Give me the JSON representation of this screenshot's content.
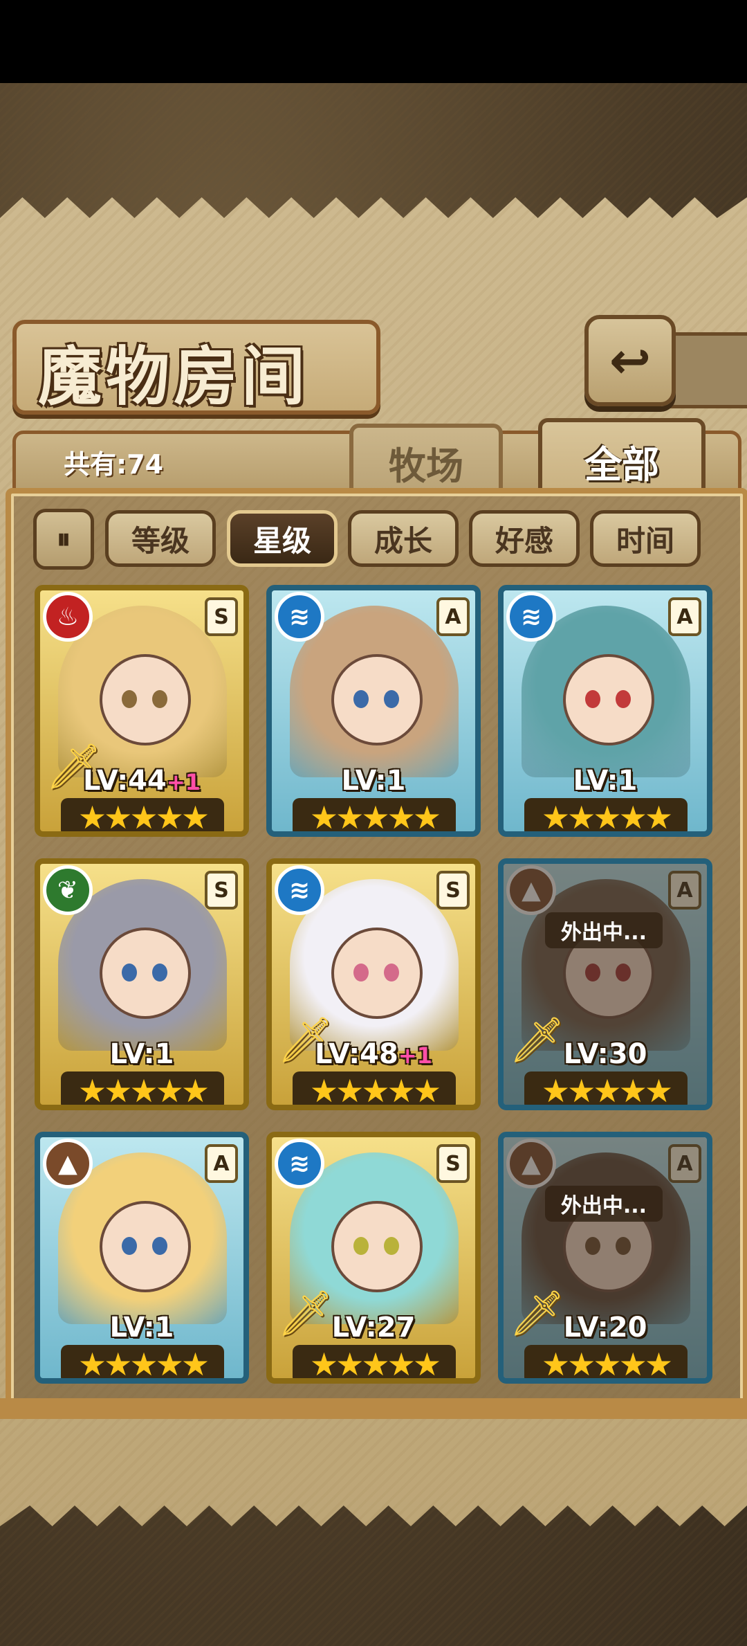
{
  "title": "魔物房间",
  "back_icon": "back-arrow-icon",
  "total_label": "共有:74",
  "tabs": [
    {
      "label": "牧场",
      "active": false
    },
    {
      "label": "全部",
      "active": true
    }
  ],
  "sort_toggle_icon": "sort-order-icon",
  "filters": [
    {
      "label": "等级",
      "active": false
    },
    {
      "label": "星级",
      "active": true
    },
    {
      "label": "成长",
      "active": false
    },
    {
      "label": "好感",
      "active": false
    },
    {
      "label": "时间",
      "active": false
    }
  ],
  "monsters": [
    {
      "element": "fire",
      "element_icon": "fire-element-icon",
      "rank": "S",
      "frame": "gold",
      "level": "LV:44",
      "bonus": "+1",
      "stars": 5,
      "sword": true,
      "away": false,
      "away_text": ""
    },
    {
      "element": "water",
      "element_icon": "water-element-icon",
      "rank": "A",
      "frame": "blue",
      "level": "LV:1",
      "bonus": "",
      "stars": 5,
      "sword": false,
      "away": false,
      "away_text": ""
    },
    {
      "element": "water",
      "element_icon": "water-element-icon",
      "rank": "A",
      "frame": "blue",
      "level": "LV:1",
      "bonus": "",
      "stars": 5,
      "sword": false,
      "away": false,
      "away_text": ""
    },
    {
      "element": "leaf",
      "element_icon": "leaf-element-icon",
      "rank": "S",
      "frame": "gold",
      "level": "LV:1",
      "bonus": "",
      "stars": 5,
      "sword": false,
      "away": false,
      "away_text": ""
    },
    {
      "element": "water",
      "element_icon": "water-element-icon",
      "rank": "S",
      "frame": "gold",
      "level": "LV:48",
      "bonus": "+1",
      "stars": 5,
      "sword": true,
      "away": false,
      "away_text": ""
    },
    {
      "element": "earth",
      "element_icon": "earth-element-icon",
      "rank": "A",
      "frame": "blue",
      "level": "LV:30",
      "bonus": "",
      "stars": 5,
      "sword": true,
      "away": true,
      "away_text": "外出中..."
    },
    {
      "element": "earth",
      "element_icon": "earth-element-icon",
      "rank": "A",
      "frame": "blue",
      "level": "LV:1",
      "bonus": "",
      "stars": 5,
      "sword": false,
      "away": false,
      "away_text": ""
    },
    {
      "element": "water",
      "element_icon": "water-element-icon",
      "rank": "S",
      "frame": "gold",
      "level": "LV:27",
      "bonus": "",
      "stars": 5,
      "sword": true,
      "away": false,
      "away_text": ""
    },
    {
      "element": "earth",
      "element_icon": "earth-element-icon",
      "rank": "A",
      "frame": "blue",
      "level": "LV:20",
      "bonus": "",
      "stars": 5,
      "sword": true,
      "away": true,
      "away_text": "外出中..."
    }
  ]
}
